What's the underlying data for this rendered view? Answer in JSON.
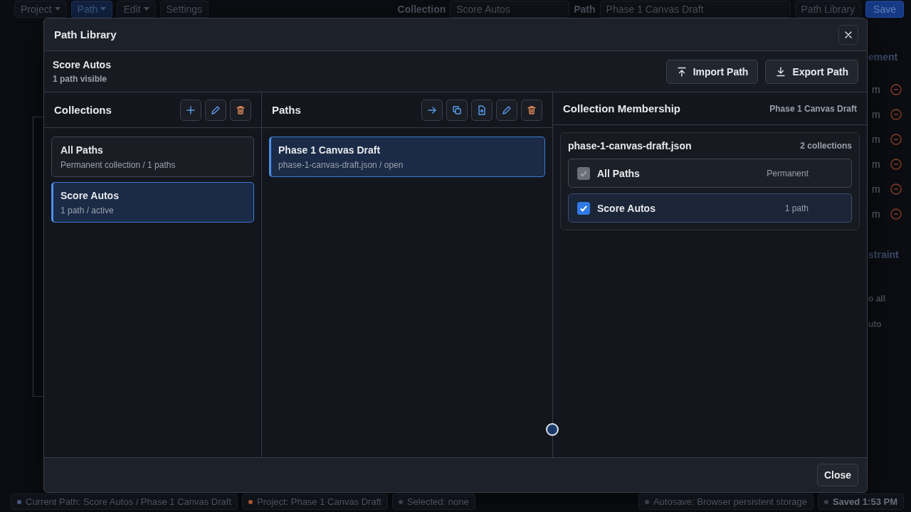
{
  "topbar": {
    "menus": [
      {
        "label": "Project",
        "kind": "dropdown",
        "selected": false
      },
      {
        "label": "Path",
        "kind": "dropdown",
        "selected": true
      },
      {
        "label": "Edit",
        "kind": "dropdown",
        "selected": false
      },
      {
        "label": "Settings",
        "kind": "button",
        "selected": false
      }
    ],
    "selects": [
      {
        "label": "Collection",
        "value": "Score Autos"
      },
      {
        "label": "Path",
        "value": "Phase 1 Canvas Draft"
      }
    ],
    "library_button": "Path Library",
    "save_button": "Save"
  },
  "side_panel": {
    "title": "ement",
    "rows": [
      "m",
      "m",
      "m",
      "m",
      "m",
      "m"
    ],
    "section": "straint",
    "buttons": [
      "o all",
      "uto"
    ]
  },
  "dialog": {
    "title": "Path Library",
    "collection": "Score Autos",
    "summary": "1 path visible",
    "import_button": "Import Path",
    "export_button": "Export Path",
    "collections": {
      "title": "Collections",
      "items": [
        {
          "name": "All Paths",
          "detail": "Permanent collection / 1 paths",
          "selected": false
        },
        {
          "name": "Score Autos",
          "detail": "1 path / active",
          "selected": true
        }
      ]
    },
    "paths": {
      "title": "Paths",
      "items": [
        {
          "name": "Phase 1 Canvas Draft",
          "detail": "phase-1-canvas-draft.json / open",
          "selected": true
        }
      ]
    },
    "membership": {
      "title": "Collection Membership",
      "path_name": "Phase 1 Canvas Draft",
      "file": "phase-1-canvas-draft.json",
      "count": "2 collections",
      "items": [
        {
          "name": "All Paths",
          "note": "Permanent",
          "checked": true,
          "disabled": true
        },
        {
          "name": "Score Autos",
          "note": "1 path",
          "checked": true,
          "disabled": false
        }
      ]
    },
    "close_button": "Close"
  },
  "status_bar": [
    {
      "text": "Current Path: Score Autos / Phase 1 Canvas Draft",
      "color": "#4a5a80"
    },
    {
      "text": "Project: Phase 1 Canvas Draft",
      "color": "#a8552e"
    },
    {
      "text": "Selected: none",
      "color": "#3a3f48"
    },
    {
      "text": "Autosave: Browser persistent storage",
      "color": "#3a3f48"
    },
    {
      "text": "Saved 1:53 PM",
      "color": "#3a3f48"
    }
  ]
}
